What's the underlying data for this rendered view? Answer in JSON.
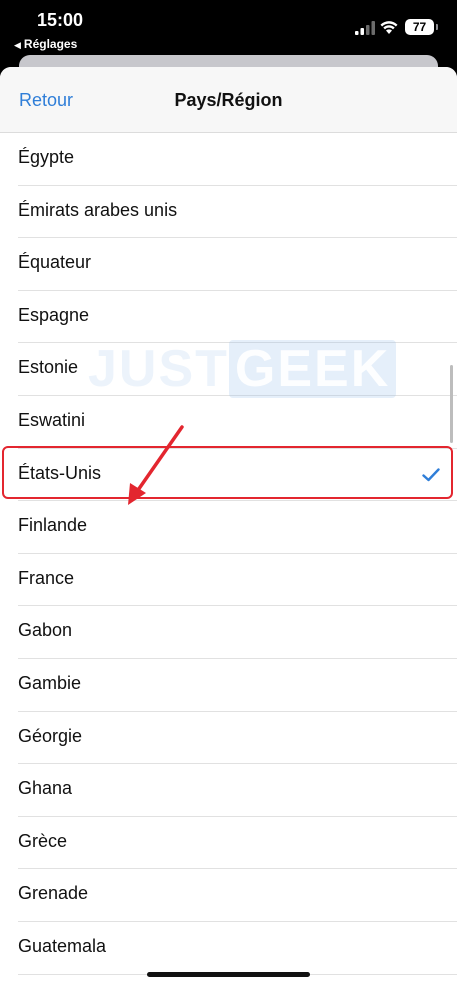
{
  "status": {
    "time": "15:00",
    "back_app": "Réglages",
    "battery": "77"
  },
  "nav": {
    "back_label": "Retour",
    "title": "Pays/Région"
  },
  "countries": [
    {
      "label": "Égypte",
      "selected": false
    },
    {
      "label": "Émirats arabes unis",
      "selected": false
    },
    {
      "label": "Équateur",
      "selected": false
    },
    {
      "label": "Espagne",
      "selected": false
    },
    {
      "label": "Estonie",
      "selected": false
    },
    {
      "label": "Eswatini",
      "selected": false
    },
    {
      "label": "États-Unis",
      "selected": true
    },
    {
      "label": "Finlande",
      "selected": false
    },
    {
      "label": "France",
      "selected": false
    },
    {
      "label": "Gabon",
      "selected": false
    },
    {
      "label": "Gambie",
      "selected": false
    },
    {
      "label": "Géorgie",
      "selected": false
    },
    {
      "label": "Ghana",
      "selected": false
    },
    {
      "label": "Grèce",
      "selected": false
    },
    {
      "label": "Grenade",
      "selected": false
    },
    {
      "label": "Guatemala",
      "selected": false
    }
  ],
  "watermark": {
    "part1": "JUST",
    "part2": "GEEK"
  },
  "colors": {
    "accent": "#2f7ed8",
    "highlight": "#e3262f"
  },
  "icons": {
    "check": "checkmark-icon",
    "arrow": "red-arrow-annotation"
  }
}
